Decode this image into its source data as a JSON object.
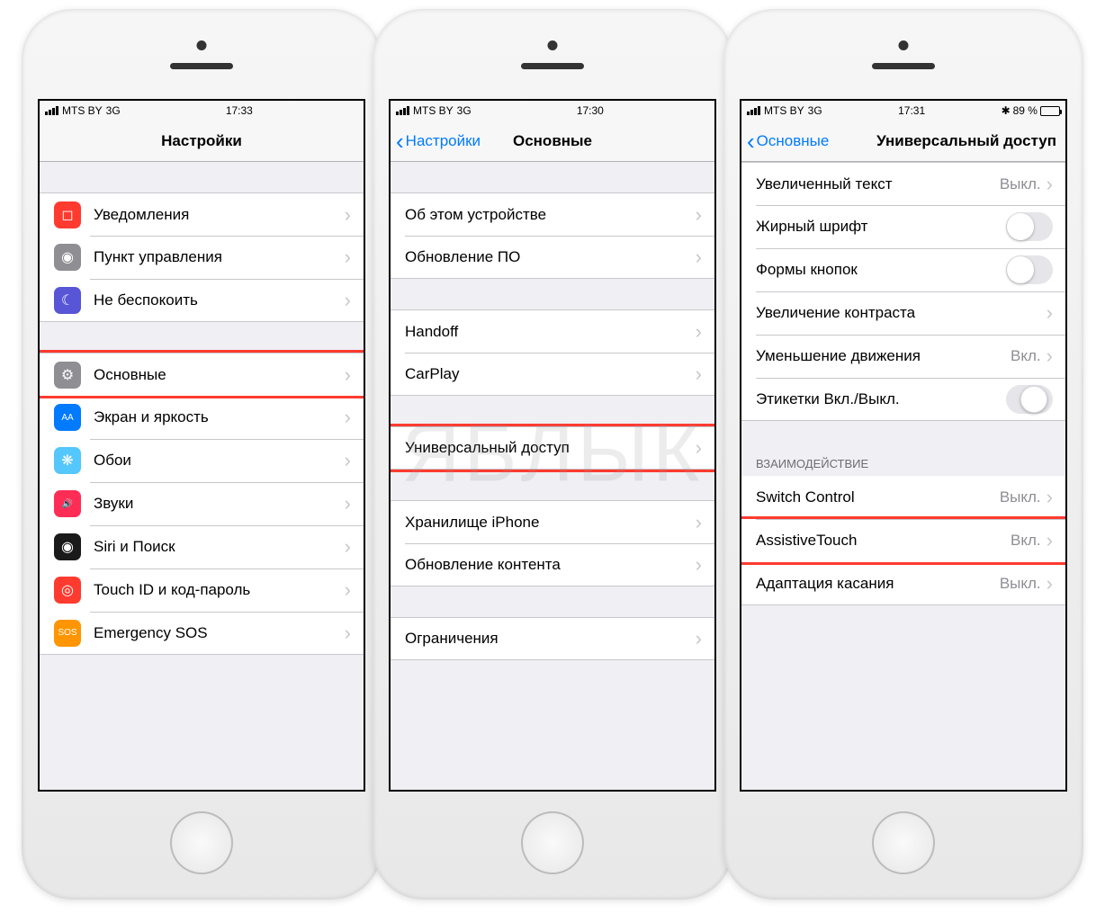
{
  "watermark": "ЯБЛЫК",
  "phones": [
    {
      "status": {
        "carrier": "MTS BY",
        "net": "3G",
        "time": "17:33"
      },
      "nav": {
        "back": null,
        "title": "Настройки"
      },
      "groups": [
        {
          "header": null,
          "rows": [
            {
              "icon": {
                "bg": "#ff3b30",
                "glyph": "◻"
              },
              "label": "Уведомления"
            },
            {
              "icon": {
                "bg": "#8e8e93",
                "glyph": "◉"
              },
              "label": "Пункт управления"
            },
            {
              "icon": {
                "bg": "#5856d6",
                "glyph": "☾"
              },
              "label": "Не беспокоить"
            }
          ]
        },
        {
          "header": null,
          "rows": [
            {
              "icon": {
                "bg": "#8e8e93",
                "glyph": "⚙"
              },
              "label": "Основные",
              "highlight": true
            },
            {
              "icon": {
                "bg": "#007aff",
                "glyph": "AA"
              },
              "label": "Экран и яркость"
            },
            {
              "icon": {
                "bg": "#54c7fc",
                "glyph": "❋"
              },
              "label": "Обои"
            },
            {
              "icon": {
                "bg": "#ff2d55",
                "glyph": "🔊"
              },
              "label": "Звуки"
            },
            {
              "icon": {
                "bg": "#1a1a1a",
                "glyph": "◉"
              },
              "label": "Siri и Поиск"
            },
            {
              "icon": {
                "bg": "#ff3b30",
                "glyph": "◎"
              },
              "label": "Touch ID и код-пароль"
            },
            {
              "icon": {
                "bg": "#ff9500",
                "glyph": "SOS"
              },
              "label": "Emergency SOS"
            }
          ]
        }
      ]
    },
    {
      "status": {
        "carrier": "MTS BY",
        "net": "3G",
        "time": "17:30"
      },
      "nav": {
        "back": "Настройки",
        "title": "Основные"
      },
      "groups": [
        {
          "header": null,
          "rows": [
            {
              "label": "Об этом устройстве"
            },
            {
              "label": "Обновление ПО"
            }
          ]
        },
        {
          "header": null,
          "rows": [
            {
              "label": "Handoff"
            },
            {
              "label": "CarPlay"
            }
          ]
        },
        {
          "header": null,
          "rows": [
            {
              "label": "Универсальный доступ",
              "highlight": true
            }
          ]
        },
        {
          "header": null,
          "rows": [
            {
              "label": "Хранилище iPhone"
            },
            {
              "label": "Обновление контента"
            }
          ]
        },
        {
          "header": null,
          "rows": [
            {
              "label": "Ограничения"
            }
          ]
        }
      ]
    },
    {
      "status": {
        "carrier": "MTS BY",
        "net": "3G",
        "time": "17:31",
        "battery": "89 %"
      },
      "nav": {
        "back": "Основные",
        "title": "Универсальный доступ",
        "shift": true
      },
      "groups": [
        {
          "header": null,
          "rows": [
            {
              "label": "Увеличенный текст",
              "value": "Выкл."
            },
            {
              "label": "Жирный шрифт",
              "toggle": "off"
            },
            {
              "label": "Формы кнопок",
              "toggle": "off"
            },
            {
              "label": "Увеличение контраста"
            },
            {
              "label": "Уменьшение движения",
              "value": "Вкл."
            },
            {
              "label": "Этикетки Вкл./Выкл.",
              "toggle": "indet"
            }
          ]
        },
        {
          "header": "ВЗАИМОДЕЙСТВИЕ",
          "rows": [
            {
              "label": "Switch Control",
              "value": "Выкл."
            },
            {
              "label": "AssistiveTouch",
              "value": "Вкл.",
              "highlight": true
            },
            {
              "label": "Адаптация касания",
              "value": "Выкл."
            }
          ]
        }
      ]
    }
  ]
}
